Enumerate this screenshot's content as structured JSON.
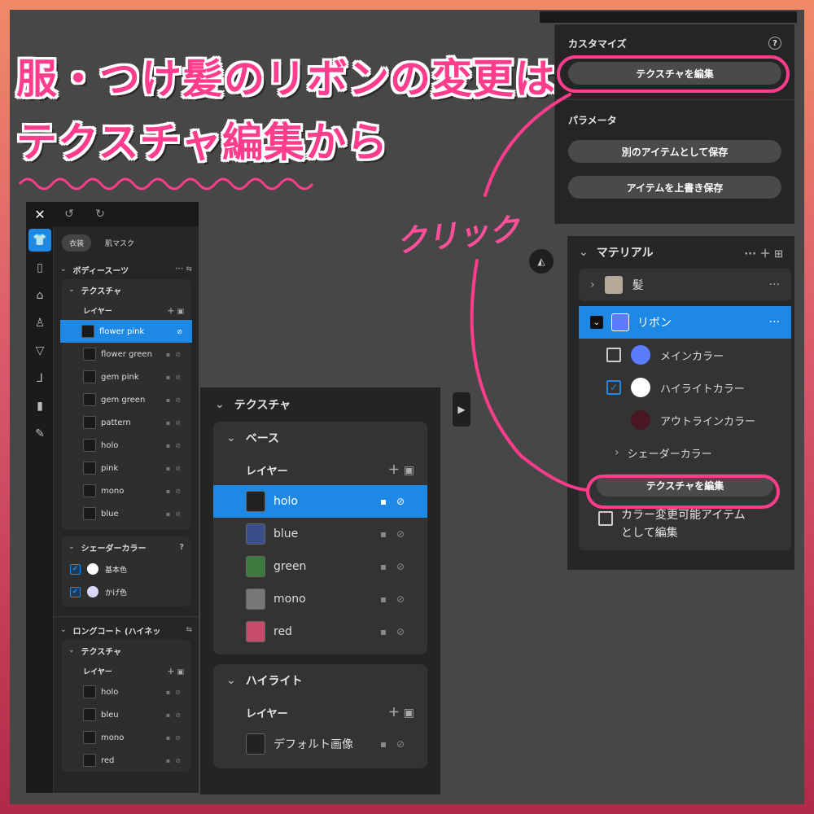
{
  "headline": {
    "line1": "服・つけ髪のリボンの変更は",
    "line2": "テクスチャ編集から"
  },
  "annotation": {
    "click": "クリック"
  },
  "left_panel": {
    "tabs": [
      "衣装",
      "肌マスク"
    ],
    "section1": {
      "title": "ボディースーツ",
      "texture_title": "テクスチャ",
      "layer_label": "レイヤー",
      "layers": [
        "flower pink",
        "flower green",
        "gem pink",
        "gem green",
        "pattern",
        "holo",
        "pink",
        "mono",
        "blue"
      ],
      "shader_title": "シェーダーカラー",
      "shader_items": [
        {
          "label": "基本色",
          "color": "#ffffff"
        },
        {
          "label": "かげ色",
          "color": "#d8d8ff"
        }
      ]
    },
    "section2": {
      "title": "ロングコート (ハイネッ",
      "texture_title": "テクスチャ",
      "layer_label": "レイヤー",
      "layers": [
        "holo",
        "bleu",
        "mono",
        "red"
      ]
    }
  },
  "middle_panel": {
    "title": "テクスチャ",
    "base": {
      "title": "ベース",
      "layer_label": "レイヤー",
      "layers": [
        "holo",
        "blue",
        "green",
        "mono",
        "red"
      ]
    },
    "highlight": {
      "title": "ハイライト",
      "layer_label": "レイヤー",
      "layers": [
        "デフォルト画像"
      ]
    }
  },
  "top_right_panel": {
    "customize_title": "カスタマイズ",
    "edit_texture": "テクスチャを編集",
    "param_title": "パラメータ",
    "save_as_new": "別のアイテムとして保存",
    "overwrite": "アイテムを上書き保存"
  },
  "material_panel": {
    "title": "マテリアル",
    "items": [
      {
        "label": "髪",
        "color": "#b4a898"
      },
      {
        "label": "リボン",
        "color": "#5a7cff"
      }
    ],
    "colors": [
      {
        "label": "メインカラー",
        "color": "#5a7cff",
        "checked": false
      },
      {
        "label": "ハイライトカラー",
        "color": "#ffffff",
        "checked": true
      },
      {
        "label": "アウトラインカラー",
        "color": "#4a1824"
      }
    ],
    "shader_color": "シェーダーカラー",
    "edit_texture": "テクスチャを編集",
    "color_changeable_line1": "カラー変更可能アイテム",
    "color_changeable_line2": "として編集"
  },
  "accent": "#1e88e5",
  "highlight_pink": "#ff3d8c"
}
